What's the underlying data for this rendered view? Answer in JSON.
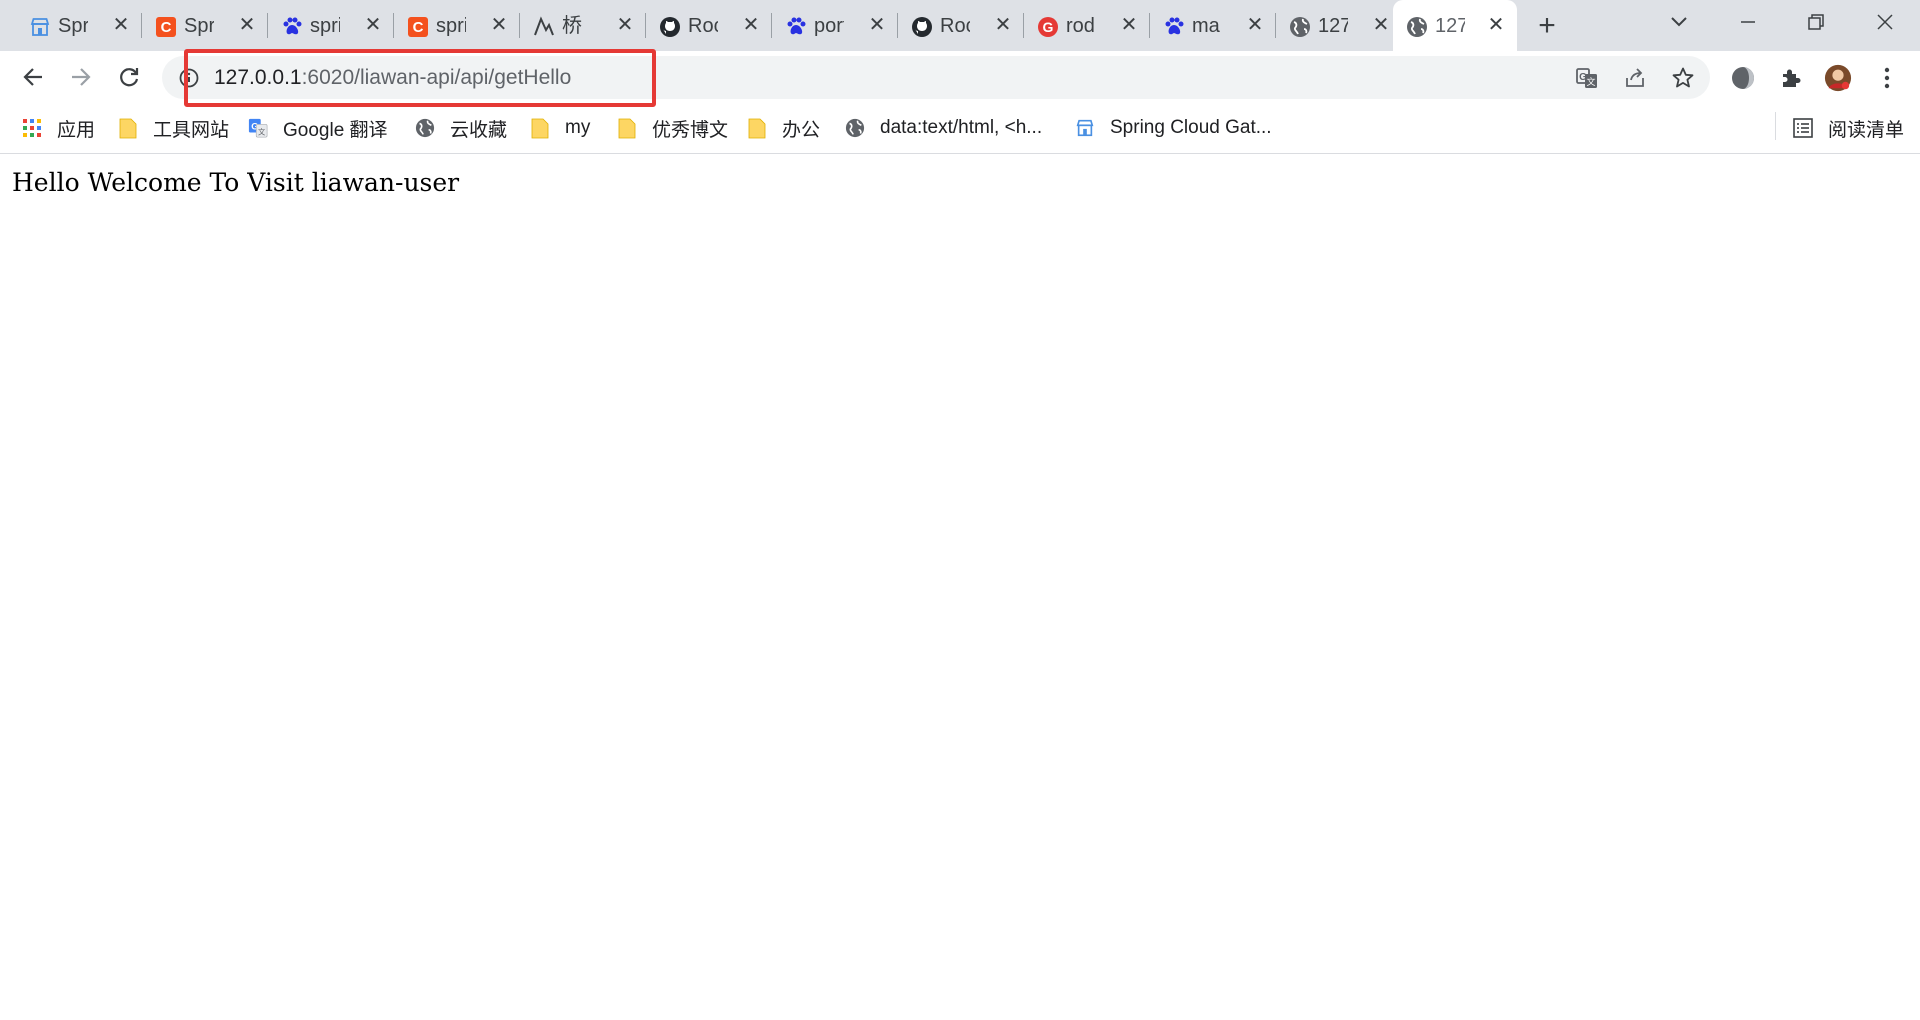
{
  "tabs": [
    {
      "title": "Spring",
      "icon": "storefront-icon",
      "active": false
    },
    {
      "title": "Spring",
      "icon": "csdn-c-icon",
      "active": false
    },
    {
      "title": "spring",
      "icon": "baidu-paw-icon",
      "active": false
    },
    {
      "title": "spring",
      "icon": "csdn-c-icon",
      "active": false
    },
    {
      "title": "桥",
      "icon": "bridge-icon",
      "active": false
    },
    {
      "title": "Roc",
      "icon": "github-icon",
      "active": false
    },
    {
      "title": "port",
      "icon": "baidu-paw-icon",
      "active": false
    },
    {
      "title": "Roc",
      "icon": "github-icon",
      "active": false
    },
    {
      "title": "rod",
      "icon": "red-g-icon",
      "active": false
    },
    {
      "title": "ma",
      "icon": "baidu-paw-icon",
      "active": false
    },
    {
      "title": "127",
      "icon": "globe-icon",
      "active": false
    },
    {
      "title": "127",
      "icon": "globe-icon",
      "active": true
    }
  ],
  "toolbar": {
    "url_host": "127.0.0.1",
    "url_rest": ":6020/liawan-api/api/getHello"
  },
  "bookmarks": [
    {
      "label": "应用",
      "icon": "apps-grid-icon"
    },
    {
      "label": "工具网站",
      "icon": "folder-icon"
    },
    {
      "label": "Google 翻译",
      "icon": "google-translate-icon"
    },
    {
      "label": "云收藏",
      "icon": "globe-icon"
    },
    {
      "label": "my",
      "icon": "folder-icon"
    },
    {
      "label": "优秀博文",
      "icon": "folder-icon"
    },
    {
      "label": "办公",
      "icon": "folder-icon"
    },
    {
      "label": "data:text/html, <h...",
      "icon": "globe-icon"
    },
    {
      "label": "Spring Cloud Gat...",
      "icon": "storefront-icon"
    }
  ],
  "reading_list": {
    "label": "阅读清单",
    "icon": "reading-list-icon"
  },
  "page": {
    "body_text": "Hello Welcome To Visit liawan-user"
  },
  "colors": {
    "highlight": "#e53935",
    "tabstrip": "#dee1e6",
    "omnibox": "#f1f3f4"
  }
}
